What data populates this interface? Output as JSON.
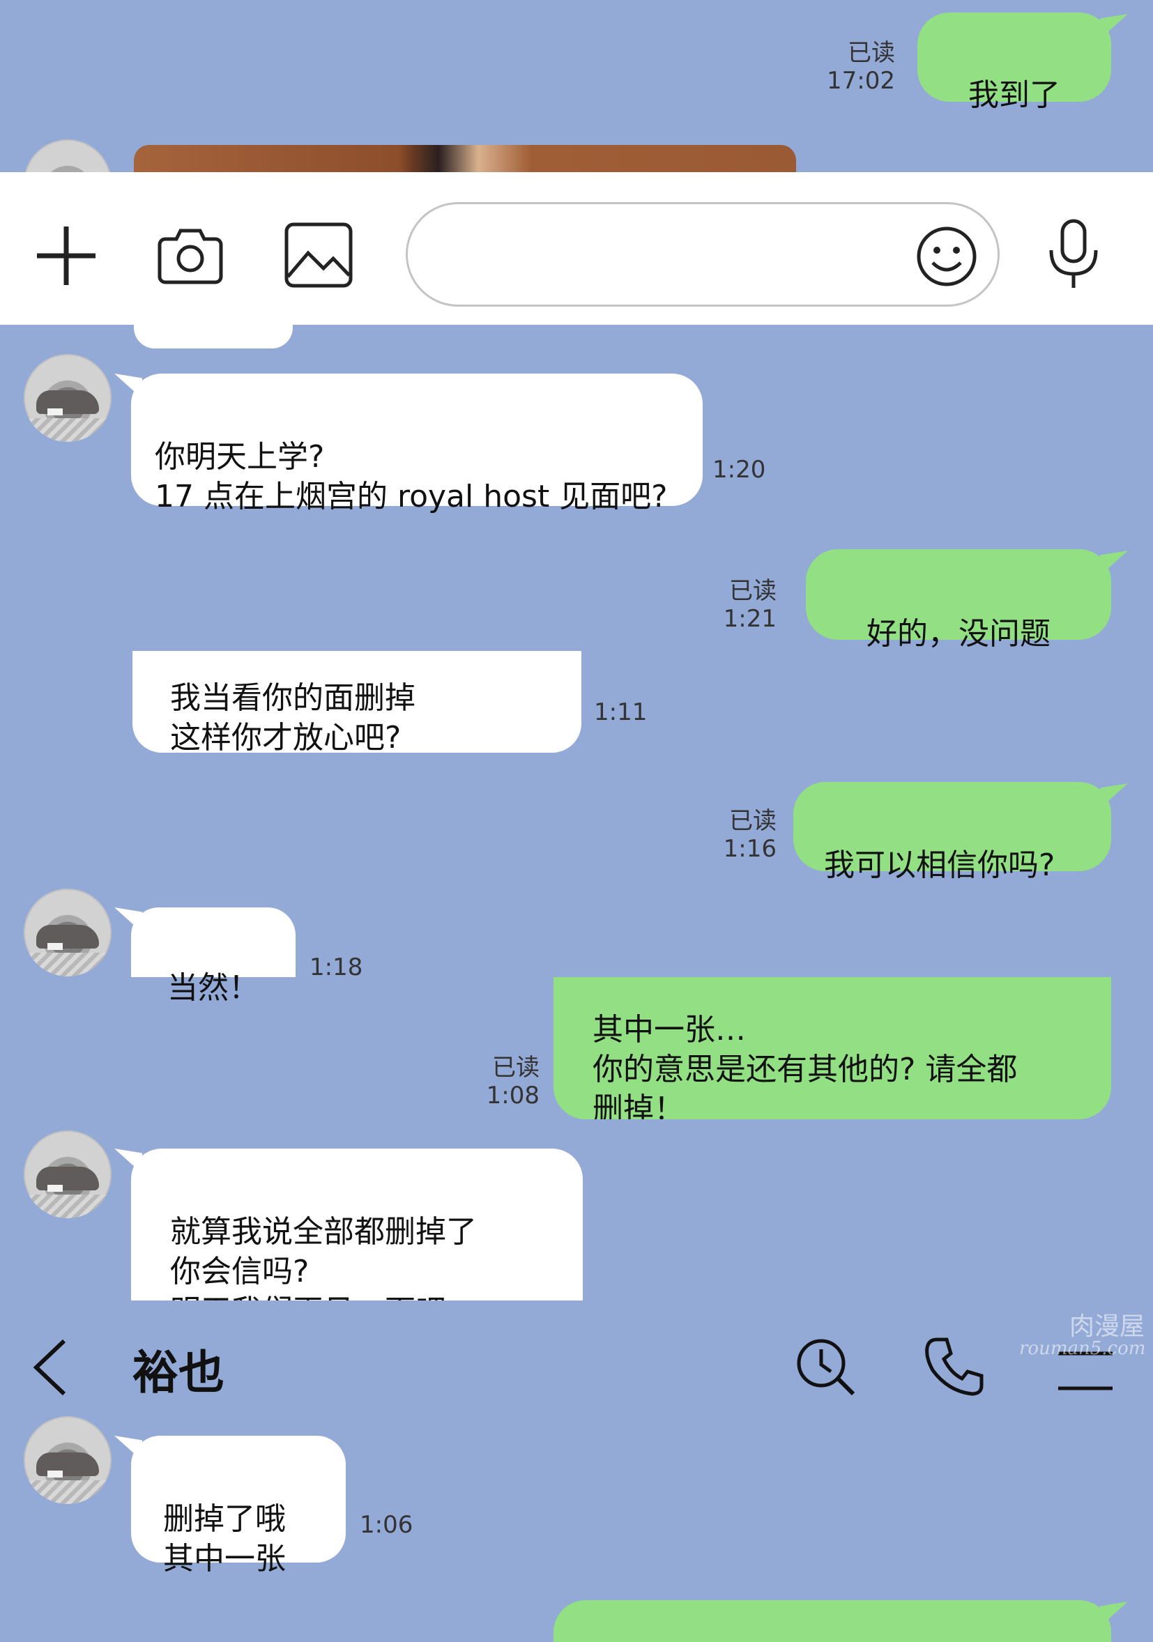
{
  "app": {
    "contact_name": "裕也",
    "watermark_top": "肉漫屋",
    "watermark_bottom": "rouman5.com"
  },
  "colors": {
    "background": "#93a9d6",
    "incoming_bubble": "#ffffff",
    "outgoing_bubble": "#92e083"
  },
  "icons": {
    "add": "plus-icon",
    "camera": "camera-icon",
    "image": "image-icon",
    "emoji": "smiley-icon",
    "mic": "microphone-icon",
    "back": "chevron-left-icon",
    "search": "search-history-icon",
    "call": "phone-icon",
    "menu": "menu-icon"
  },
  "messages": {
    "m1": {
      "text": "我到了",
      "read": "已读",
      "time": "17:02"
    },
    "m2": {
      "text": "你明天上学?\n17 点在上烟宫的 royal host 见面吧?",
      "time": "1:20"
    },
    "m3": {
      "text": "好的，没问题",
      "read": "已读",
      "time": "1:21"
    },
    "m4": {
      "text": "我当看你的面删掉\n这样你才放心吧?",
      "time": "1:11"
    },
    "m5": {
      "text": "我可以相信你吗?",
      "read": "已读",
      "time": "1:16"
    },
    "m6": {
      "text": "当然！",
      "time": "1:18"
    },
    "m7": {
      "text": "其中一张…\n你的意思是还有其他的? 请全都\n删掉！",
      "read": "已读",
      "time": "1:08"
    },
    "m8": {
      "text": "就算我说全部都删掉了\n你会信吗?\n明天我们再见一面吧\n我当着你的面删掉",
      "time": ""
    },
    "m9": {
      "text": "删掉了哦\n其中一张",
      "time": "1:06"
    }
  }
}
